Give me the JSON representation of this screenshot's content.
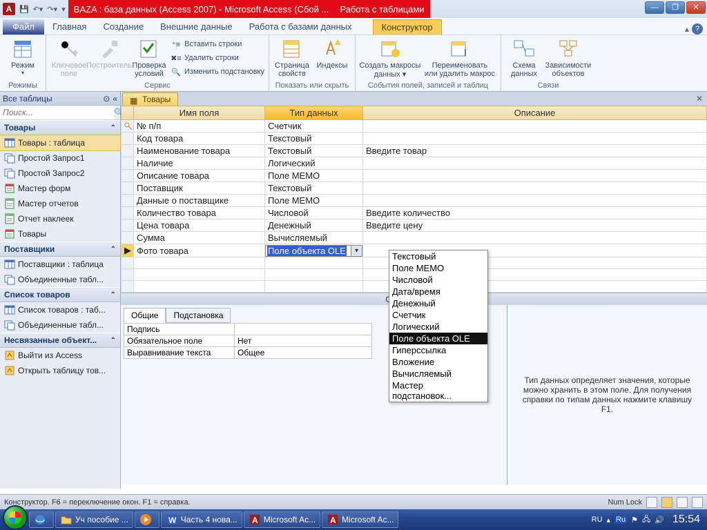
{
  "title": {
    "doc": "BAZA : база данных (Access 2007)  -  Microsoft Access (Сбой ...",
    "context_group": "Работа с таблицами"
  },
  "tabs": {
    "file": "Файл",
    "home": "Главная",
    "create": "Создание",
    "external": "Внешние данные",
    "dbtools": "Работа с базами данных",
    "design": "Конструктор"
  },
  "ribbon": {
    "groups": {
      "modes": "Режимы",
      "service": "Сервис",
      "showhide": "Показать или скрыть",
      "events": "События полей, записей и таблиц",
      "relations": "Связи"
    },
    "modes_btn": "Режим",
    "primary_key": "Ключевое\nполе",
    "builder": "Построитель",
    "validation": "Проверка\nусловий",
    "insert_rows": "Вставить строки",
    "delete_rows": "Удалить строки",
    "modify_lookup": "Изменить подстановку",
    "property_sheet": "Страница\nсвойств",
    "indexes": "Индексы",
    "create_macros": "Создать макросы\nданных ▾",
    "rename_macro": "Переименовать\nили удалить макрос",
    "relationships": "Схема\nданных",
    "dependencies": "Зависимости\nобъектов"
  },
  "nav": {
    "header": "Все таблицы",
    "search_ph": "Поиск...",
    "groups": [
      {
        "title": "Товары",
        "items": [
          {
            "label": "Товары : таблица",
            "icon": "table",
            "selected": true
          },
          {
            "label": "Простой Запрос1",
            "icon": "query"
          },
          {
            "label": "Простой Запрос2",
            "icon": "query"
          },
          {
            "label": "Мастер форм",
            "icon": "form"
          },
          {
            "label": "Мастер отчетов",
            "icon": "report"
          },
          {
            "label": "Отчет наклеек",
            "icon": "report"
          },
          {
            "label": "Товары",
            "icon": "form"
          }
        ]
      },
      {
        "title": "Поставщики",
        "items": [
          {
            "label": "Поставщики : таблица",
            "icon": "table"
          },
          {
            "label": "Объединенные табл...",
            "icon": "query"
          }
        ]
      },
      {
        "title": "Список товаров",
        "items": [
          {
            "label": "Список товаров : таб...",
            "icon": "table"
          },
          {
            "label": "Объединенные табл...",
            "icon": "query"
          }
        ]
      },
      {
        "title": "Несвязанные объект...",
        "items": [
          {
            "label": "Выйти из Access",
            "icon": "macro"
          },
          {
            "label": "Открыть таблицу тов...",
            "icon": "macro"
          }
        ]
      }
    ]
  },
  "doc_tab": "Товары",
  "grid": {
    "col_name": "Имя поля",
    "col_type": "Тип данных",
    "col_desc": "Описание",
    "rows": [
      {
        "pk": true,
        "name": "№ п/п",
        "type": "Счетчик",
        "desc": ""
      },
      {
        "name": "Код товара",
        "type": "Текстовый",
        "desc": ""
      },
      {
        "name": "Наименование товара",
        "type": "Текстовый",
        "desc": "Введите товар"
      },
      {
        "name": "Наличие",
        "type": "Логический",
        "desc": ""
      },
      {
        "name": "Описание товара",
        "type": "Поле МЕМО",
        "desc": ""
      },
      {
        "name": "Поставщик",
        "type": "Текстовый",
        "desc": ""
      },
      {
        "name": "Данные о поставщике",
        "type": "Поле МЕМО",
        "desc": ""
      },
      {
        "name": "Количество товара",
        "type": "Числовой",
        "desc": "Введите количество"
      },
      {
        "name": "Цена товара",
        "type": "Денежный",
        "desc": "Введите цену"
      },
      {
        "name": "Сумма",
        "type": "Вычисляемый",
        "desc": ""
      },
      {
        "name": "Фото товара",
        "type": "Поле объекта OLE",
        "desc": "",
        "selected": true
      }
    ]
  },
  "type_options": [
    "Текстовый",
    "Поле МЕМО",
    "Числовой",
    "Дата/время",
    "Денежный",
    "Счетчик",
    "Логический",
    "Поле объекта OLE",
    "Гиперссылка",
    "Вложение",
    "Вычисляемый",
    "Мастер подстановок..."
  ],
  "type_selected": "Поле объекта OLE",
  "props": {
    "panel_title": "Свойства поля",
    "tab_general": "Общие",
    "tab_lookup": "Подстановка",
    "rows": [
      {
        "k": "Подпись",
        "v": ""
      },
      {
        "k": "Обязательное поле",
        "v": "Нет"
      },
      {
        "k": "Выравнивание текста",
        "v": "Общее"
      }
    ],
    "hint": "Тип данных определяет значения, которые можно хранить в этом поле. Для получения справки по типам данных нажмите клавишу F1."
  },
  "status": {
    "left": "Конструктор.  F6 = переключение окон.  F1 = справка.",
    "numlock": "Num Lock"
  },
  "taskbar": {
    "items": [
      {
        "label": "",
        "icon": "ie"
      },
      {
        "label": "Уч пособие ...",
        "icon": "folder"
      },
      {
        "label": "",
        "icon": "wmp"
      },
      {
        "label": "Часть 4 нова...",
        "icon": "word"
      },
      {
        "label": "Microsoft Ac...",
        "icon": "access"
      },
      {
        "label": "Microsoft Ac...",
        "icon": "access"
      }
    ],
    "lang": "RU",
    "clock": "15:54"
  }
}
